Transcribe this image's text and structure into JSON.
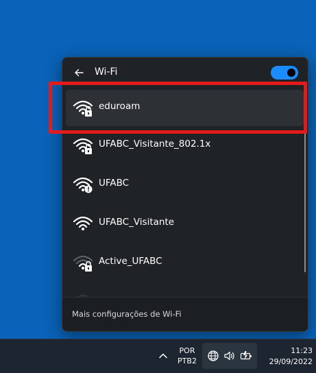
{
  "wifi_panel": {
    "title": "Wi-Fi",
    "toggle_on": true,
    "networks": [
      {
        "name": "eduroam",
        "secured": true,
        "selected": true
      },
      {
        "name": "UFABC_Visitante_802.1x",
        "secured": true
      },
      {
        "name": "UFABC",
        "secured": false,
        "warning": true
      },
      {
        "name": "UFABC_Visitante",
        "secured": false
      },
      {
        "name": "Active_UFABC",
        "secured": true,
        "signal": "weak"
      }
    ],
    "footer_link": "Mais configurações de Wi-Fi"
  },
  "taskbar": {
    "language_line1": "POR",
    "language_line2": "PTB2",
    "time": "11:23",
    "date": "29/09/2022"
  },
  "colors": {
    "desktop": "#0a63b8",
    "panel": "#202326",
    "accent": "#1a8cff",
    "highlight": "#e31b1b"
  }
}
